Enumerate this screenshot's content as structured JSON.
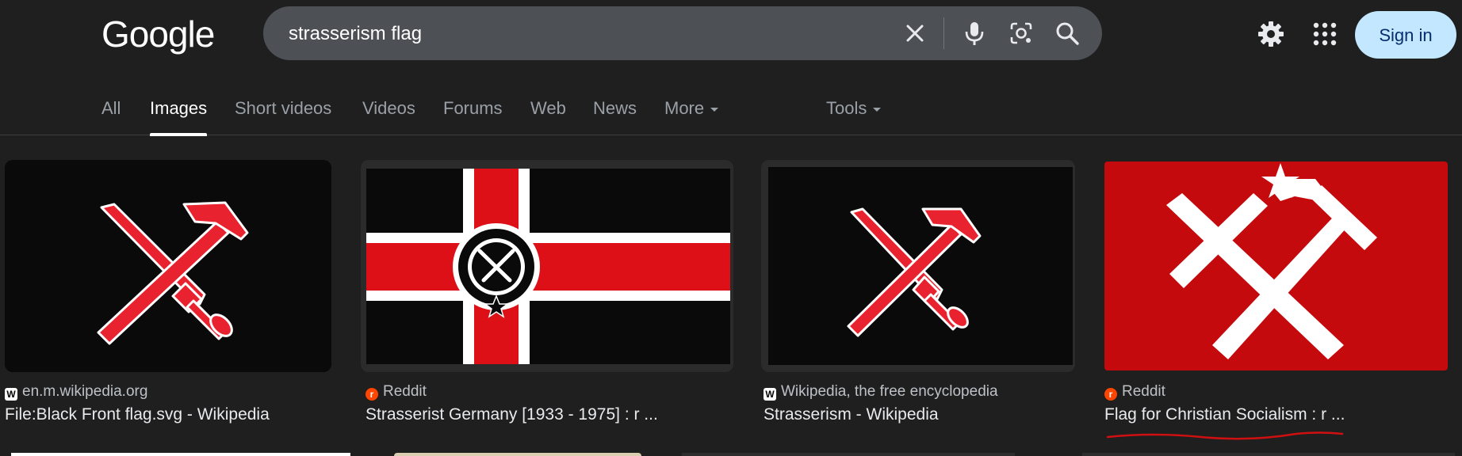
{
  "header": {
    "logo": "Google",
    "search_query": "strasserism flag",
    "icons": [
      "clear-icon",
      "mic-icon",
      "lens-icon",
      "search-icon",
      "gear-icon",
      "apps-icon"
    ],
    "sign_in_label": "Sign in"
  },
  "tabs": [
    {
      "label": "All"
    },
    {
      "label": "Images",
      "active": true
    },
    {
      "label": "Short videos"
    },
    {
      "label": "Videos"
    },
    {
      "label": "Forums"
    },
    {
      "label": "Web"
    },
    {
      "label": "News"
    },
    {
      "label": "More"
    },
    {
      "label": "Tools"
    }
  ],
  "results": [
    {
      "source": "en.m.wikipedia.org",
      "title": "File:Black Front flag.svg - Wikipedia",
      "favicon": "W"
    },
    {
      "source": "Reddit",
      "title": "Strasserist Germany [1933 - 1975] : r ...",
      "favicon": "reddit"
    },
    {
      "source": "Wikipedia, the free encyclopedia",
      "title": "Strasserism - Wikipedia",
      "favicon": "W"
    },
    {
      "source": "Reddit",
      "title": "Flag for Christian Socialism : r ...",
      "favicon": "reddit"
    }
  ],
  "colors": {
    "background": "#1f1f1f",
    "search_bar": "#4d5156",
    "sign_in_bg": "#c2e7ff",
    "flag_red": "#e0202e",
    "annotation_red": "#d01010"
  }
}
